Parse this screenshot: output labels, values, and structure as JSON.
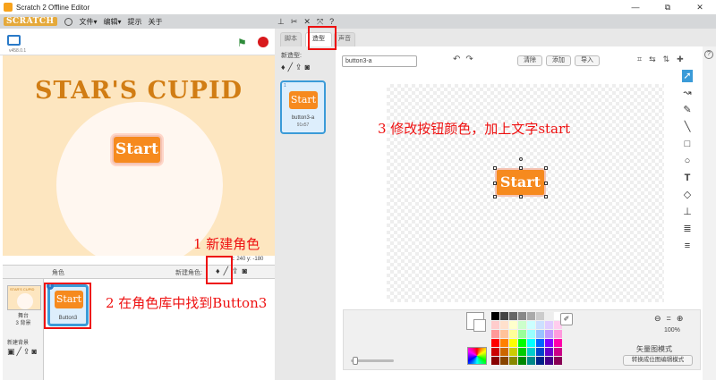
{
  "window": {
    "title": "Scratch 2 Offline Editor",
    "controls": [
      "—",
      "⧉",
      "✕"
    ]
  },
  "menubar": {
    "logo": "SCRATCH",
    "items": [
      "文件▾",
      "编辑▾",
      "提示",
      "关于"
    ],
    "tool_icons": [
      "duplicate-icon",
      "delete-icon",
      "grow-icon",
      "shrink-icon",
      "help-icon"
    ]
  },
  "stage": {
    "version": "v458.0.1",
    "title_art": "STAR'S CUPID",
    "start_button": "Start",
    "coords_x": "x: 240",
    "coords_y": "y: -180",
    "background_color": "#fde6c0"
  },
  "sprites_panel": {
    "header_label": "角色",
    "new_sprite_label": "新建角色:",
    "stage_thumb_text": "STAR'S CUPID",
    "stage_label": "舞台",
    "stage_backdrops": "3 背景",
    "new_backdrop_label": "新建背景",
    "sprite": {
      "name": "Button3",
      "text": "Start",
      "badge": "i"
    }
  },
  "tabs": [
    {
      "label": "脚本",
      "active": false
    },
    {
      "label": "造型",
      "active": true
    },
    {
      "label": "声音",
      "active": false
    }
  ],
  "costumes": {
    "new_costume_label": "新造型:",
    "items": [
      {
        "index": "1",
        "text": "Start",
        "name": "button3-a",
        "size": "91x57"
      }
    ]
  },
  "paint_editor": {
    "costume_name": "button3-a",
    "buttons": [
      "清除",
      "添加",
      "导入"
    ],
    "canvas_button_text": "Start",
    "zoom_pct": "100%",
    "mode_label": "矢量图模式",
    "convert_label": "转换成位图编辑模式",
    "tools": [
      "select-arrow-icon",
      "reshape-icon",
      "pencil-icon",
      "line-icon",
      "rectangle-icon",
      "ellipse-icon",
      "text-icon",
      "fill-icon",
      "stamp-icon",
      "front-icon",
      "back-icon"
    ]
  },
  "palette": [
    "#000000",
    "#444444",
    "#666666",
    "#888888",
    "#aaaaaa",
    "#cccccc",
    "#eeeeee",
    "#ffffff",
    "#ffcccc",
    "#ffe0cc",
    "#ffffcc",
    "#ccffcc",
    "#ccffff",
    "#cce0ff",
    "#e0ccff",
    "#ffccee",
    "#ff9999",
    "#ffc299",
    "#ffff99",
    "#99ff99",
    "#99ffff",
    "#99c2ff",
    "#c299ff",
    "#ff99dd",
    "#ff0000",
    "#ff8000",
    "#ffff00",
    "#00ff00",
    "#00ffff",
    "#0066ff",
    "#8000ff",
    "#ff00aa",
    "#cc0000",
    "#cc6600",
    "#cccc00",
    "#00cc00",
    "#00cccc",
    "#0044cc",
    "#6600cc",
    "#cc0088",
    "#880000",
    "#884400",
    "#888800",
    "#008800",
    "#008888",
    "#002288",
    "#440088",
    "#880055"
  ],
  "annotations": {
    "a1": "1  新建角色",
    "a2": "2  在角色库中找到Button3",
    "a3": "3  修改按钮颜色，加上文字start",
    "color": "#e11111"
  }
}
